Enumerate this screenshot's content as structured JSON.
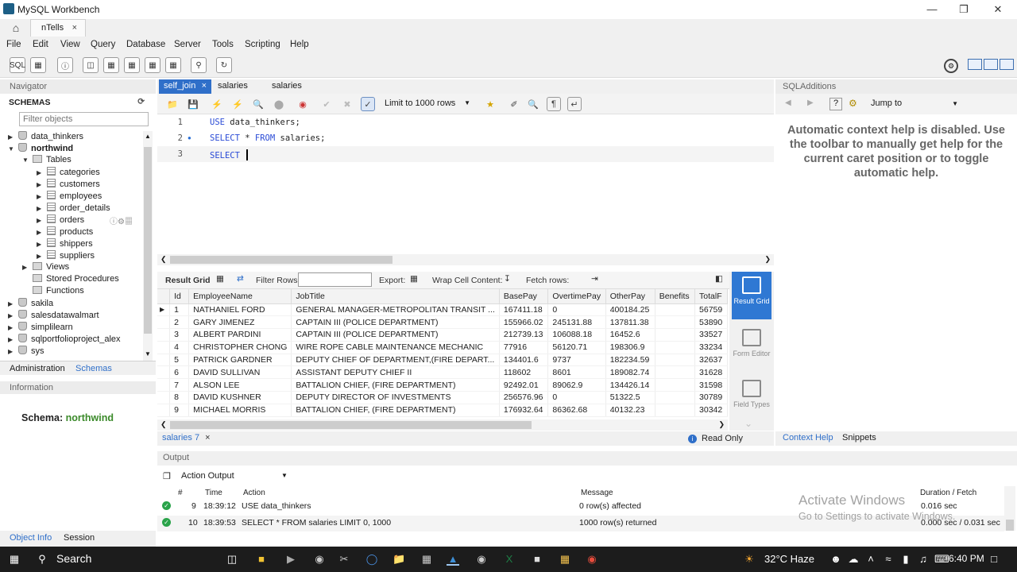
{
  "window": {
    "title": "MySQL Workbench"
  },
  "connection_tab": {
    "label": "nTells",
    "close": "×"
  },
  "menu": [
    "File",
    "Edit",
    "View",
    "Query",
    "Database",
    "Server",
    "Tools",
    "Scripting",
    "Help"
  ],
  "navigator": {
    "header": "Navigator",
    "schemas_label": "SCHEMAS",
    "filter_placeholder": "Filter objects",
    "tree": {
      "data_thinkers": "data_thinkers",
      "northwind": "northwind",
      "tables": "Tables",
      "table_items": [
        "categories",
        "customers",
        "employees",
        "order_details",
        "orders",
        "products",
        "shippers",
        "suppliers"
      ],
      "views": "Views",
      "stored_procedures": "Stored Procedures",
      "functions": "Functions",
      "other_schemas": [
        "sakila",
        "salesdatawalmart",
        "simplilearn",
        "sqlportfolioproject_alex",
        "sys"
      ]
    },
    "tabs": {
      "administration": "Administration",
      "schemas": "Schemas"
    },
    "information_header": "Information",
    "schema_info": {
      "label": "Schema:",
      "value": "northwind"
    },
    "bottom_tabs": {
      "object_info": "Object Info",
      "session": "Session"
    }
  },
  "editor": {
    "tabs": [
      {
        "label": "self_join",
        "close": "×"
      },
      {
        "label": "salaries"
      },
      {
        "label": "salaries"
      }
    ],
    "limit_select": "Limit to 1000 rows",
    "lines": [
      {
        "no": "1",
        "kw": "USE",
        "rest": " data_thinkers;"
      },
      {
        "no": "2",
        "kw": "SELECT",
        "mid": " * ",
        "kw2": "FROM",
        "rest": " salaries;"
      },
      {
        "no": "3",
        "kw": "SELECT",
        "rest": " "
      }
    ]
  },
  "result_toolbar": {
    "result_grid": "Result Grid",
    "filter_rows": "Filter Rows:",
    "export": "Export:",
    "wrap": "Wrap Cell Content:",
    "fetch_rows": "Fetch rows:"
  },
  "result_grid": {
    "columns": [
      "Id",
      "EmployeeName",
      "JobTitle",
      "BasePay",
      "OvertimePay",
      "OtherPay",
      "Benefits",
      "TotalF"
    ],
    "rows": [
      [
        "1",
        "NATHANIEL FORD",
        "GENERAL MANAGER-METROPOLITAN TRANSIT ...",
        "167411.18",
        "0",
        "400184.25",
        "",
        "56759"
      ],
      [
        "2",
        "GARY JIMENEZ",
        "CAPTAIN III (POLICE DEPARTMENT)",
        "155966.02",
        "245131.88",
        "137811.38",
        "",
        "53890"
      ],
      [
        "3",
        "ALBERT PARDINI",
        "CAPTAIN III (POLICE DEPARTMENT)",
        "212739.13",
        "106088.18",
        "16452.6",
        "",
        "33527"
      ],
      [
        "4",
        "CHRISTOPHER CHONG",
        "WIRE ROPE CABLE MAINTENANCE MECHANIC",
        "77916",
        "56120.71",
        "198306.9",
        "",
        "33234"
      ],
      [
        "5",
        "PATRICK GARDNER",
        "DEPUTY CHIEF OF DEPARTMENT,(FIRE DEPART...",
        "134401.6",
        "9737",
        "182234.59",
        "",
        "32637"
      ],
      [
        "6",
        "DAVID SULLIVAN",
        "ASSISTANT DEPUTY CHIEF II",
        "118602",
        "8601",
        "189082.74",
        "",
        "31628"
      ],
      [
        "7",
        "ALSON LEE",
        "BATTALION CHIEF, (FIRE DEPARTMENT)",
        "92492.01",
        "89062.9",
        "134426.14",
        "",
        "31598"
      ],
      [
        "8",
        "DAVID KUSHNER",
        "DEPUTY DIRECTOR OF INVESTMENTS",
        "256576.96",
        "0",
        "51322.5",
        "",
        "30789"
      ],
      [
        "9",
        "MICHAEL MORRIS",
        "BATTALION CHIEF, (FIRE DEPARTMENT)",
        "176932.64",
        "86362.68",
        "40132.23",
        "",
        "30342"
      ]
    ]
  },
  "result_side": {
    "result_grid": "Result Grid",
    "form_editor": "Form Editor",
    "field_types": "Field Types"
  },
  "result_tabs": {
    "tab": "salaries 7",
    "close": "×",
    "read_only": "Read Only"
  },
  "output": {
    "header": "Output",
    "mode": "Action Output",
    "columns": {
      "num": "#",
      "time": "Time",
      "action": "Action",
      "message": "Message",
      "duration": "Duration / Fetch"
    },
    "rows": [
      {
        "num": "9",
        "time": "18:39:12",
        "action": "USE data_thinkers",
        "message": "0 row(s) affected",
        "duration": "0.016 sec"
      },
      {
        "num": "10",
        "time": "18:39:53",
        "action": "SELECT * FROM salaries LIMIT 0, 1000",
        "message": "1000 row(s) returned",
        "duration": "0.000 sec / 0.031 sec"
      }
    ]
  },
  "sql_additions": {
    "header": "SQLAdditions",
    "jump_to": "Jump to",
    "help_text": "Automatic context help is disabled. Use the toolbar to manually get help for the current caret position or to toggle automatic help.",
    "tabs": {
      "context_help": "Context Help",
      "snippets": "Snippets"
    }
  },
  "watermark": {
    "line1": "Activate Windows",
    "line2": "Go to Settings to activate Windows."
  },
  "taskbar": {
    "search": "Search",
    "weather": "32°C  Haze",
    "time": "6:40 PM"
  }
}
